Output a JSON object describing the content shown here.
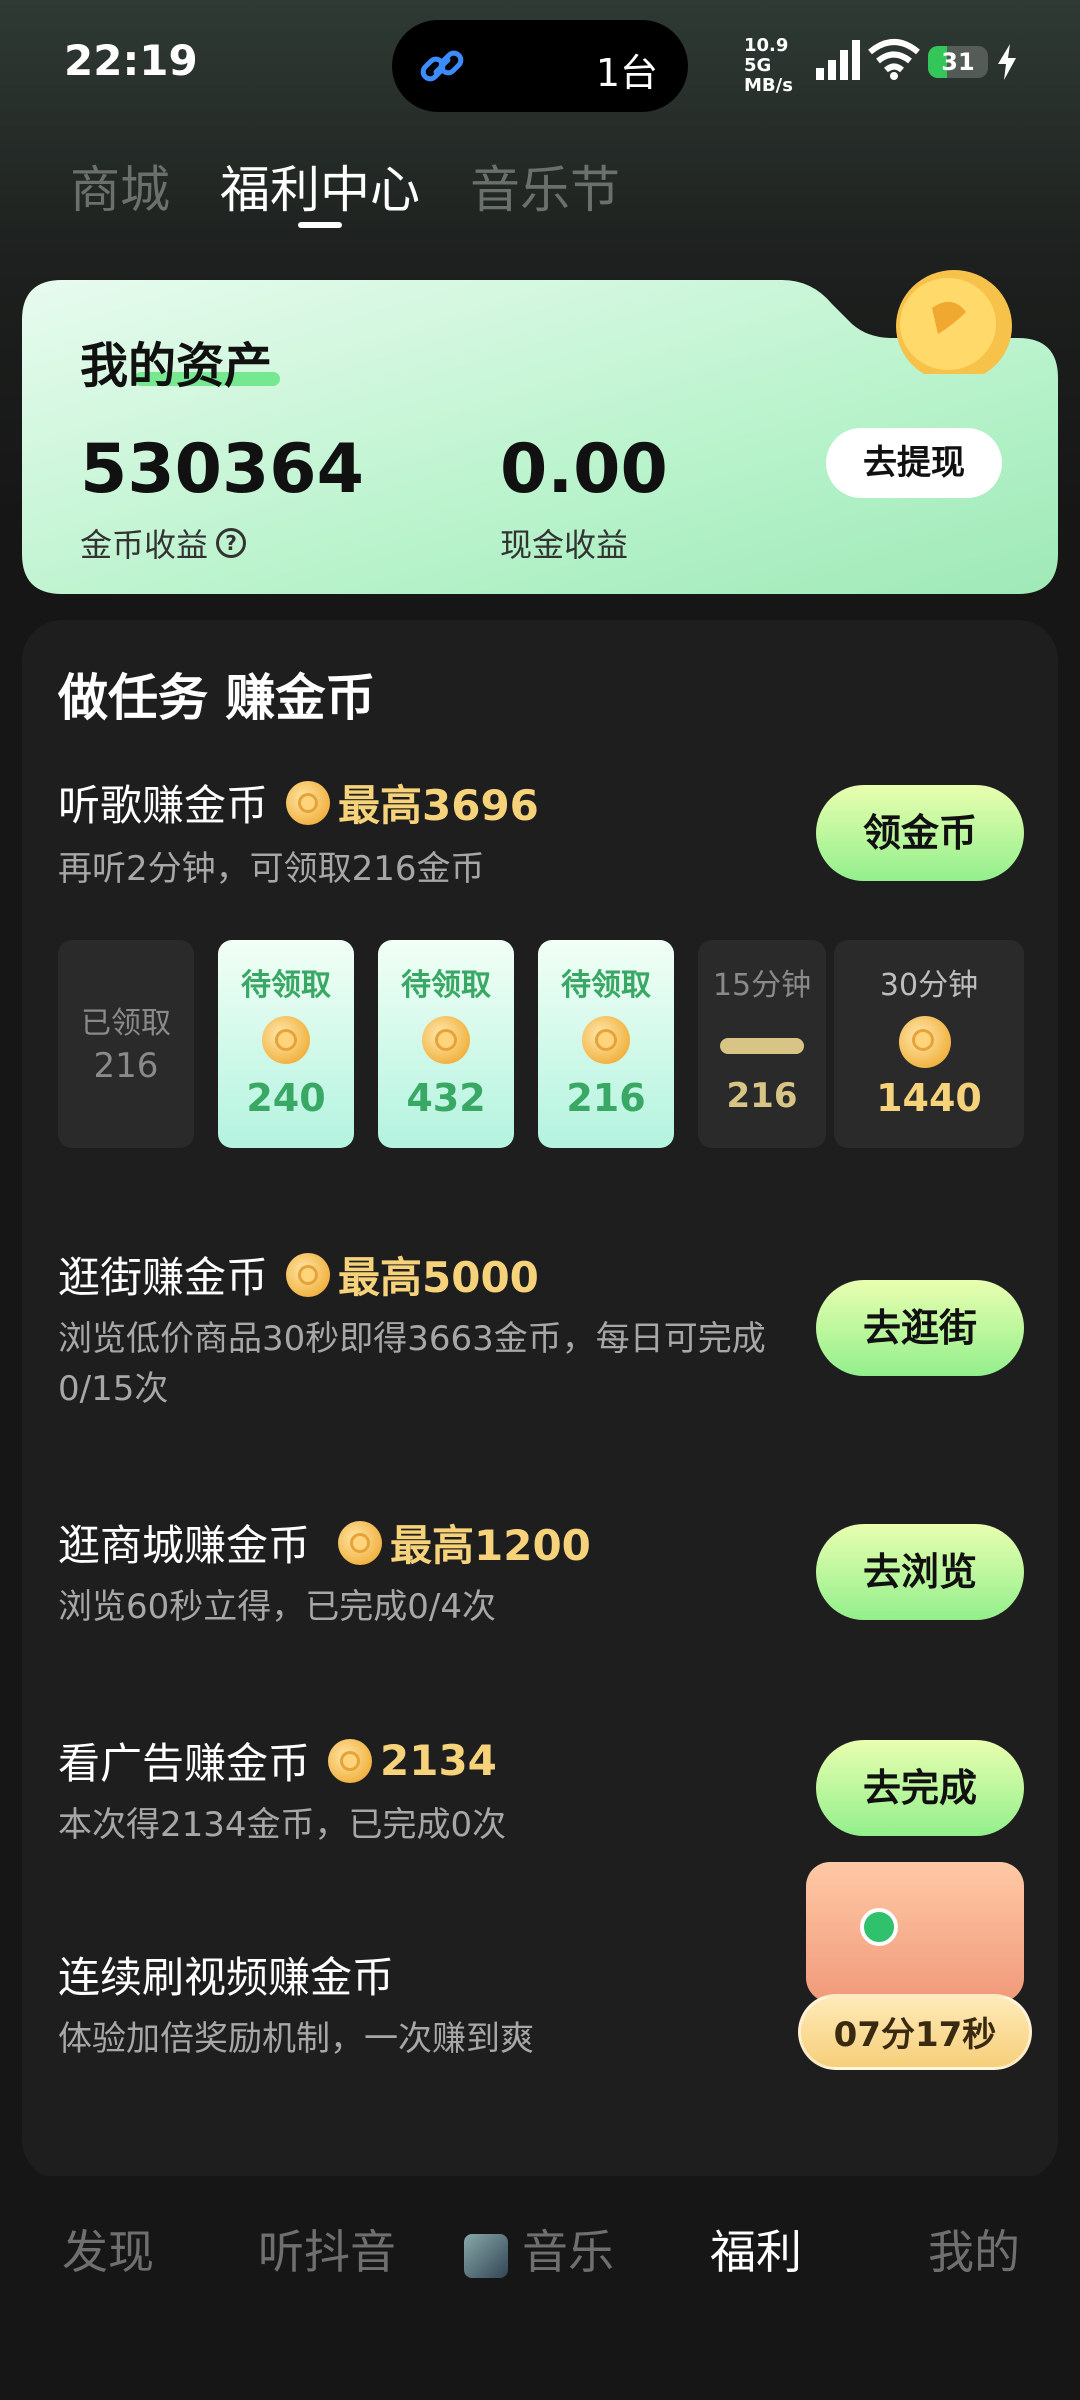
{
  "status_bar": {
    "time": "22:19",
    "island_text": "1台",
    "net_speed": "10.9",
    "net_unit": "MB/s",
    "net_type": "5G",
    "battery": "31",
    "battery_level": 0.31
  },
  "tabs": [
    {
      "label": "商城",
      "active": false
    },
    {
      "label": "福利中心",
      "active": true
    },
    {
      "label": "音乐节",
      "active": false
    }
  ],
  "assets": {
    "title": "我的资产",
    "coins_value": "530364",
    "coins_label": "金币收益",
    "cash_value": "0.00",
    "cash_label": "现金收益",
    "withdraw_label": "去提现"
  },
  "tasks_panel": {
    "title": "做任务 赚金币",
    "tasks": [
      {
        "title": "听歌赚金币",
        "reward": "最高3696",
        "desc": "再听2分钟，可领取216金币",
        "button": "领金币"
      },
      {
        "title": "逛街赚金币",
        "reward": "最高5000",
        "desc": "浏览低价商品30秒即得3663金币，每日可完成0/15次",
        "button": "去逛街"
      },
      {
        "title": "逛商城赚金币",
        "reward": "最高1200",
        "desc": "浏览60秒立得，已完成0/4次",
        "button": "去浏览"
      },
      {
        "title": "看广告赚金币",
        "reward": "2134",
        "desc": "本次得2134金币，已完成0次",
        "button": "去完成"
      },
      {
        "title": "连续刷视频赚金币",
        "reward": "",
        "desc": "体验加倍奖励机制，一次赚到爽",
        "button": ""
      }
    ],
    "reward_cells": [
      {
        "label": "已领取",
        "value": "216",
        "state": "claimed"
      },
      {
        "label": "待领取",
        "value": "240",
        "state": "pending"
      },
      {
        "label": "待领取",
        "value": "432",
        "state": "pending"
      },
      {
        "label": "待领取",
        "value": "216",
        "state": "pending"
      },
      {
        "label": "15分钟",
        "value": "216",
        "state": "locked"
      },
      {
        "label": "30分钟",
        "value": "1440",
        "state": "locked"
      }
    ]
  },
  "treasure": {
    "timer": "07分17秒"
  },
  "bottom_nav": [
    {
      "label": "发现",
      "active": false
    },
    {
      "label": "听抖音",
      "active": false
    },
    {
      "label": "音乐",
      "active": false
    },
    {
      "label": "福利",
      "active": true
    },
    {
      "label": "我的",
      "active": false
    }
  ],
  "colors": {
    "accent_green": "#93ef8c",
    "reward_gold": "#f6d37a",
    "pending_green": "#3aa865"
  }
}
